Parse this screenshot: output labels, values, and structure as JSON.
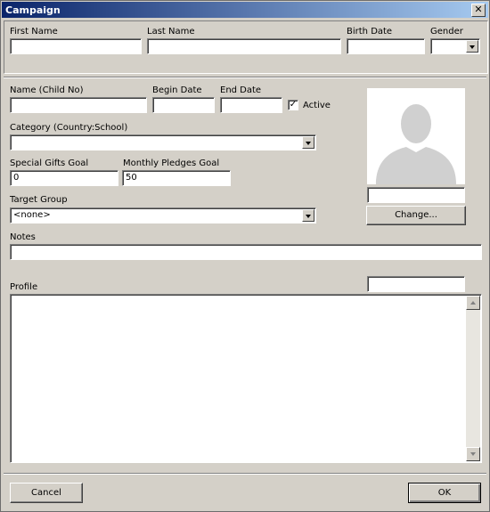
{
  "window": {
    "title": "Campaign",
    "close_glyph": "✕"
  },
  "personal": {
    "first_name_label": "First Name",
    "first_name_value": "",
    "last_name_label": "Last Name",
    "last_name_value": "",
    "birth_date_label": "Birth Date",
    "birth_date_value": "",
    "gender_label": "Gender",
    "gender_value": ""
  },
  "child": {
    "name_label": "Name (Child No)",
    "name_value": "",
    "begin_date_label": "Begin Date",
    "begin_date_value": "",
    "end_date_label": "End Date",
    "end_date_value": "",
    "active_label": "Active",
    "active_checked": true,
    "check_glyph": "✓"
  },
  "category": {
    "label": "Category (Country:School)",
    "value": ""
  },
  "goals": {
    "special_label": "Special Gifts Goal",
    "special_value": "0",
    "monthly_label": "Monthly Pledges Goal",
    "monthly_value": "50"
  },
  "target_group": {
    "label": "Target Group",
    "value": "<none>"
  },
  "notes": {
    "label": "Notes",
    "value": ""
  },
  "photo": {
    "caption_value": "",
    "change_button_label": "Change..."
  },
  "profile": {
    "label": "Profile",
    "field_value": "",
    "memo_value": ""
  },
  "footer": {
    "cancel_label": "Cancel",
    "ok_label": "OK"
  },
  "colors": {
    "titlebar_start": "#0a246a",
    "titlebar_end": "#a6caf0",
    "dialog_bg": "#d4d0c8"
  }
}
